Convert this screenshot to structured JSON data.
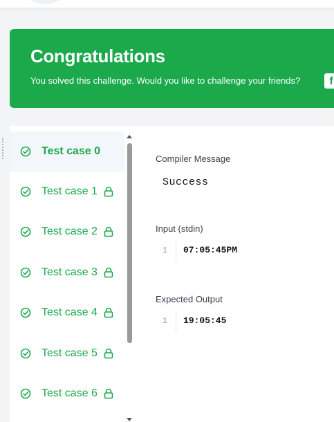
{
  "banner": {
    "title": "Congratulations",
    "subtitle": "You solved this challenge. Would you like to challenge your friends?",
    "share_icon": "facebook-icon",
    "share_glyph": "f"
  },
  "test_cases": [
    {
      "label": "Test case 0",
      "active": true,
      "locked": false
    },
    {
      "label": "Test case 1",
      "active": false,
      "locked": true
    },
    {
      "label": "Test case 2",
      "active": false,
      "locked": true
    },
    {
      "label": "Test case 3",
      "active": false,
      "locked": true
    },
    {
      "label": "Test case 4",
      "active": false,
      "locked": true
    },
    {
      "label": "Test case 5",
      "active": false,
      "locked": true
    },
    {
      "label": "Test case 6",
      "active": false,
      "locked": true
    }
  ],
  "details": {
    "compiler_label": "Compiler Message",
    "compiler_message": "Success",
    "input_label": "Input (stdin)",
    "input_line_no": "1",
    "input_value": "07:05:45PM",
    "expected_label": "Expected Output",
    "expected_line_no": "1",
    "expected_value": "19:05:45"
  },
  "colors": {
    "accent": "#1ba94c",
    "banner_text": "#ffffff",
    "active_row": "#f3f6fa"
  }
}
